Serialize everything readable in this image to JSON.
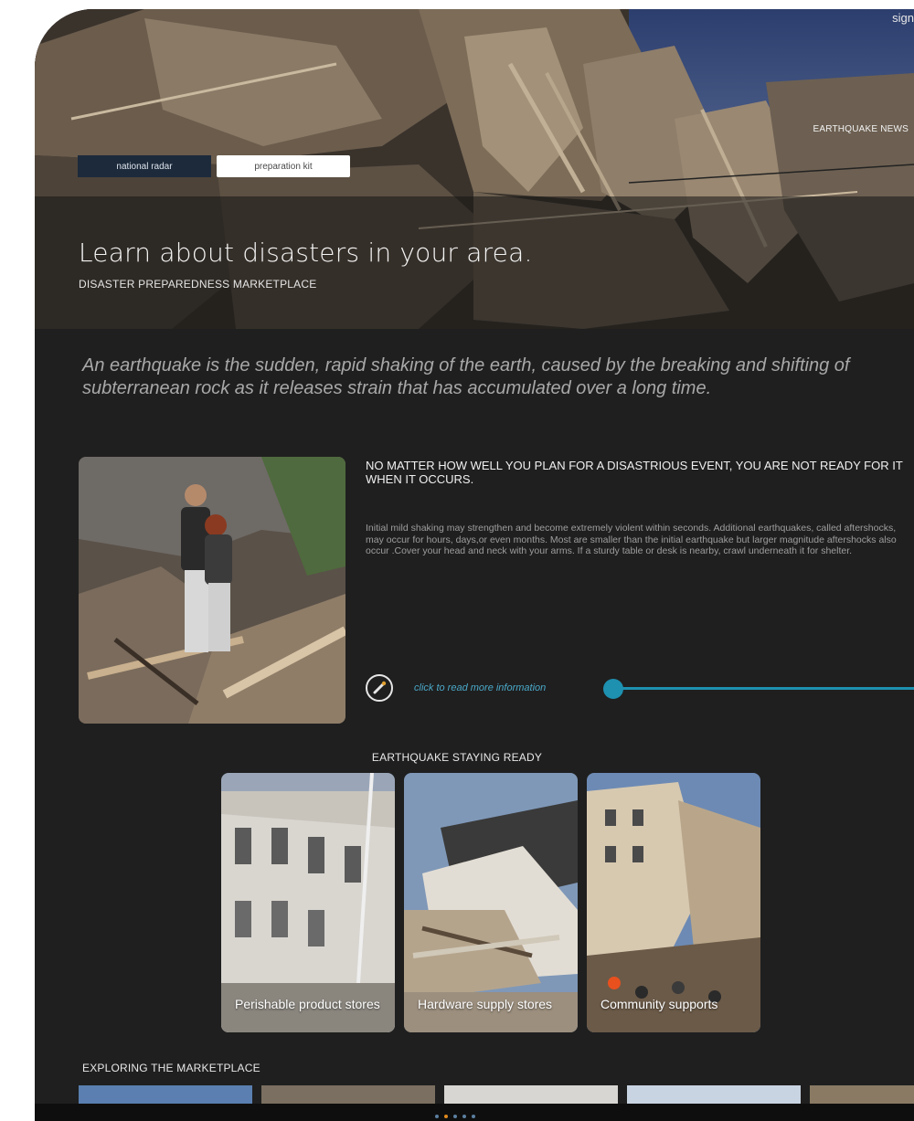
{
  "header": {
    "sign_text": "sign",
    "news_link": "EARTHQUAKE NEWS",
    "tabs": [
      {
        "label": "national radar"
      },
      {
        "label": "preparation kit"
      }
    ],
    "title": "Learn about disasters in your area.",
    "subtitle": "DISASTER PREPAREDNESS MARKETPLACE"
  },
  "intro": {
    "text": "An earthquake is the sudden, rapid shaking of the earth, caused by the breaking and shifting of subterranean rock as it releases strain that has accumulated over a long time."
  },
  "feature": {
    "heading": "NO MATTER HOW WELL YOU PLAN FOR A DISASTRIOUS EVENT, YOU ARE NOT READY FOR IT WHEN IT OCCURS.",
    "body": "Initial mild shaking may strengthen and become extremely violent within seconds. Additional earthquakes, called aftershocks, may occur for hours, days,or even months. Most are smaller than the initial earthquake but larger magnitude aftershocks also occur .Cover your head and neck with your arms. If a sturdy table or desk is nearby, crawl underneath it for shelter.",
    "read_more": "click to read more information",
    "read_more_icon": "pen-icon"
  },
  "staying_ready": {
    "title": "EARTHQUAKE STAYING READY",
    "cards": [
      {
        "label": "Perishable product stores"
      },
      {
        "label": "Hardware supply stores"
      },
      {
        "label": "Community supports"
      }
    ]
  },
  "marketplace": {
    "title": "EXPLORING THE MARKETPLACE"
  },
  "pager": {
    "count": 5,
    "active_index": 1
  },
  "colors": {
    "background": "#1f1f1f",
    "accent": "#1e90b0",
    "active_dot": "#e08a1e",
    "inactive_dot": "#5b7fa0",
    "radar_tab": "#1d2a3b"
  }
}
